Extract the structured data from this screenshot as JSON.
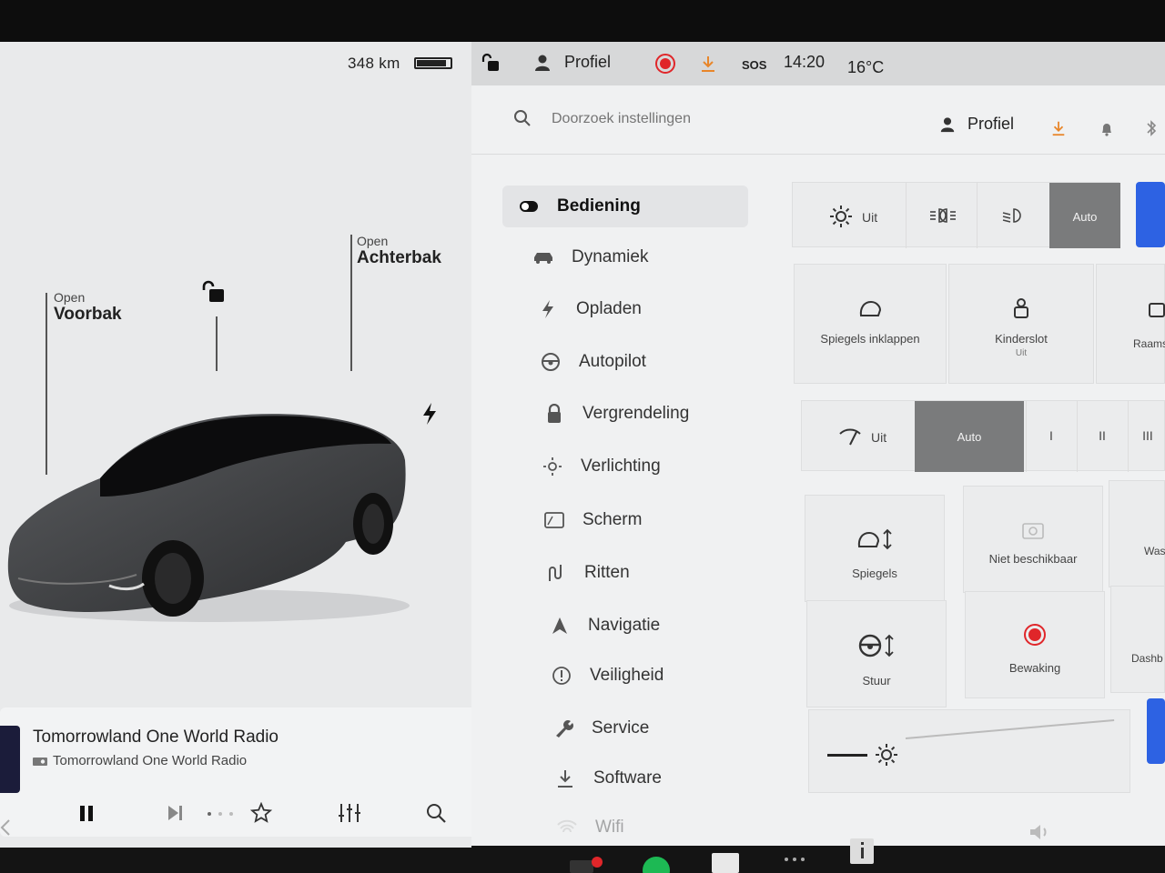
{
  "status": {
    "range": "348 km",
    "battery_level": 0.9,
    "profile": "Profiel",
    "sos": "SOS",
    "time": "14:20",
    "temperature": "16°C"
  },
  "vehicle": {
    "frunk": {
      "state": "Open",
      "label": "Voorbak"
    },
    "trunk": {
      "state": "Open",
      "label": "Achterbak"
    }
  },
  "media": {
    "station_title": "Tomorrowland One World Radio",
    "station_subtitle": "Tomorrowland One World Radio"
  },
  "search": {
    "placeholder": "Doorzoek instellingen",
    "profile": "Profiel"
  },
  "menu": {
    "items": [
      {
        "label": "Bediening",
        "icon": "toggle-icon"
      },
      {
        "label": "Dynamiek",
        "icon": "car-icon"
      },
      {
        "label": "Opladen",
        "icon": "bolt-icon"
      },
      {
        "label": "Autopilot",
        "icon": "steering-wheel-icon"
      },
      {
        "label": "Vergrendeling",
        "icon": "lock-icon"
      },
      {
        "label": "Verlichting",
        "icon": "light-icon"
      },
      {
        "label": "Scherm",
        "icon": "display-icon"
      },
      {
        "label": "Ritten",
        "icon": "trips-icon"
      },
      {
        "label": "Navigatie",
        "icon": "navigation-icon"
      },
      {
        "label": "Veiligheid",
        "icon": "safety-icon"
      },
      {
        "label": "Service",
        "icon": "wrench-icon"
      },
      {
        "label": "Software",
        "icon": "download-icon"
      },
      {
        "label": "Wifi",
        "icon": "wifi-icon"
      }
    ],
    "active_index": 0
  },
  "controls": {
    "headlights": {
      "off": "Uit",
      "auto": "Auto"
    },
    "tiles_row1": {
      "fold_mirrors": "Spiegels inklappen",
      "child_lock": "Kinderslot",
      "child_lock_state": "Uit",
      "windows": "Raams"
    },
    "wipers": {
      "off": "Uit",
      "auto": "Auto",
      "speeds": [
        "I",
        "II",
        "III"
      ]
    },
    "tiles_row2": {
      "mirrors": "Spiegels",
      "unavailable": "Niet beschikbaar",
      "wash": "Was"
    },
    "tiles_row3": {
      "steering": "Stuur",
      "sentry": "Bewaking",
      "dashcam": "Dashb"
    },
    "brightness_level": 0.12
  },
  "colors": {
    "accent_blue": "#2d62e3",
    "record_red": "#e0262a",
    "download_orange": "#e8862a"
  }
}
